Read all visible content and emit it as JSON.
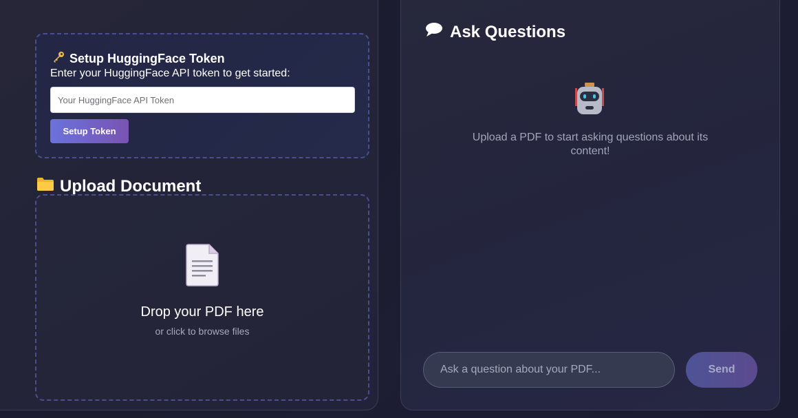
{
  "token_section": {
    "title": "Setup HuggingFace Token",
    "description": "Enter your HuggingFace API token to get started:",
    "input_placeholder": "Your HuggingFace API Token",
    "button_label": "Setup Token",
    "icon": "key-icon"
  },
  "upload_section": {
    "title": "Upload Document",
    "icon": "folder-icon",
    "drop_title": "Drop your PDF here",
    "drop_subtitle": "or click to browse files",
    "doc_icon": "document-icon"
  },
  "chat_section": {
    "title": "Ask Questions",
    "icon": "speech-bubble-icon",
    "empty_icon": "robot-icon",
    "empty_message": "Upload a PDF to start asking questions about its content!",
    "input_placeholder": "Ask a question about your PDF...",
    "send_label": "Send"
  },
  "colors": {
    "accent_start": "#6a72dc",
    "accent_end": "#7a53b3",
    "dashed_border": "#4a4f8f"
  }
}
